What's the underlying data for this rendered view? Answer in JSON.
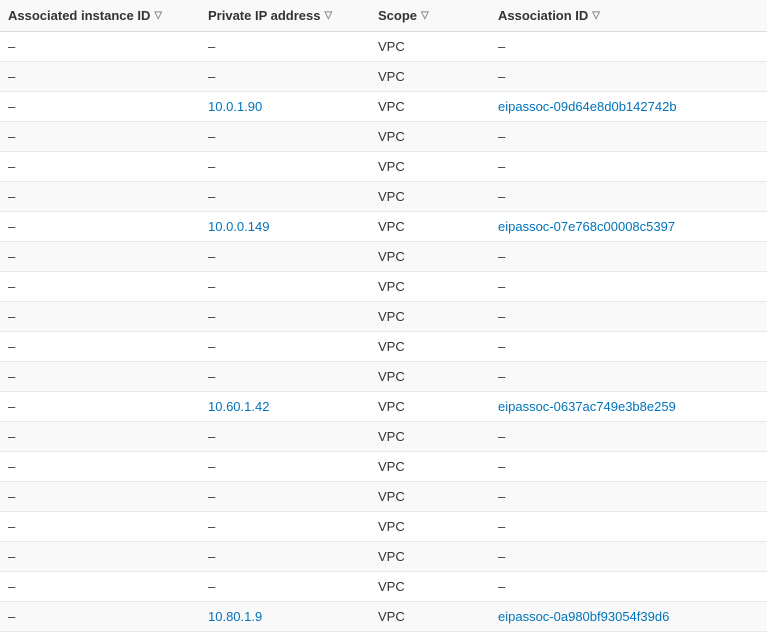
{
  "table": {
    "columns": [
      {
        "id": "instance",
        "label": "Associated instance ID"
      },
      {
        "id": "private_ip",
        "label": "Private IP address"
      },
      {
        "id": "scope",
        "label": "Scope"
      },
      {
        "id": "association",
        "label": "Association ID"
      }
    ],
    "rows": [
      {
        "instance": "–",
        "private_ip": "–",
        "scope": "VPC",
        "association": "–",
        "ip_link": false,
        "assoc_link": false
      },
      {
        "instance": "–",
        "private_ip": "–",
        "scope": "VPC",
        "association": "–",
        "ip_link": false,
        "assoc_link": false
      },
      {
        "instance": "–",
        "private_ip": "10.0.1.90",
        "scope": "VPC",
        "association": "eipassoc-09d64e8d0b142742b",
        "ip_link": true,
        "assoc_link": true
      },
      {
        "instance": "–",
        "private_ip": "–",
        "scope": "VPC",
        "association": "–",
        "ip_link": false,
        "assoc_link": false
      },
      {
        "instance": "–",
        "private_ip": "–",
        "scope": "VPC",
        "association": "–",
        "ip_link": false,
        "assoc_link": false
      },
      {
        "instance": "–",
        "private_ip": "–",
        "scope": "VPC",
        "association": "–",
        "ip_link": false,
        "assoc_link": false
      },
      {
        "instance": "–",
        "private_ip": "10.0.0.149",
        "scope": "VPC",
        "association": "eipassoc-07e768c00008c5397",
        "ip_link": true,
        "assoc_link": true
      },
      {
        "instance": "–",
        "private_ip": "–",
        "scope": "VPC",
        "association": "–",
        "ip_link": false,
        "assoc_link": false
      },
      {
        "instance": "–",
        "private_ip": "–",
        "scope": "VPC",
        "association": "–",
        "ip_link": false,
        "assoc_link": false
      },
      {
        "instance": "–",
        "private_ip": "–",
        "scope": "VPC",
        "association": "–",
        "ip_link": false,
        "assoc_link": false
      },
      {
        "instance": "–",
        "private_ip": "–",
        "scope": "VPC",
        "association": "–",
        "ip_link": false,
        "assoc_link": false
      },
      {
        "instance": "–",
        "private_ip": "–",
        "scope": "VPC",
        "association": "–",
        "ip_link": false,
        "assoc_link": false
      },
      {
        "instance": "–",
        "private_ip": "10.60.1.42",
        "scope": "VPC",
        "association": "eipassoc-0637ac749e3b8e259",
        "ip_link": true,
        "assoc_link": true
      },
      {
        "instance": "–",
        "private_ip": "–",
        "scope": "VPC",
        "association": "–",
        "ip_link": false,
        "assoc_link": false
      },
      {
        "instance": "–",
        "private_ip": "–",
        "scope": "VPC",
        "association": "–",
        "ip_link": false,
        "assoc_link": false
      },
      {
        "instance": "–",
        "private_ip": "–",
        "scope": "VPC",
        "association": "–",
        "ip_link": false,
        "assoc_link": false
      },
      {
        "instance": "–",
        "private_ip": "–",
        "scope": "VPC",
        "association": "–",
        "ip_link": false,
        "assoc_link": false
      },
      {
        "instance": "–",
        "private_ip": "–",
        "scope": "VPC",
        "association": "–",
        "ip_link": false,
        "assoc_link": false
      },
      {
        "instance": "–",
        "private_ip": "–",
        "scope": "VPC",
        "association": "–",
        "ip_link": false,
        "assoc_link": false
      },
      {
        "instance": "–",
        "private_ip": "10.80.1.9",
        "scope": "VPC",
        "association": "eipassoc-0a980bf93054f39d6",
        "ip_link": true,
        "assoc_link": true
      }
    ]
  }
}
